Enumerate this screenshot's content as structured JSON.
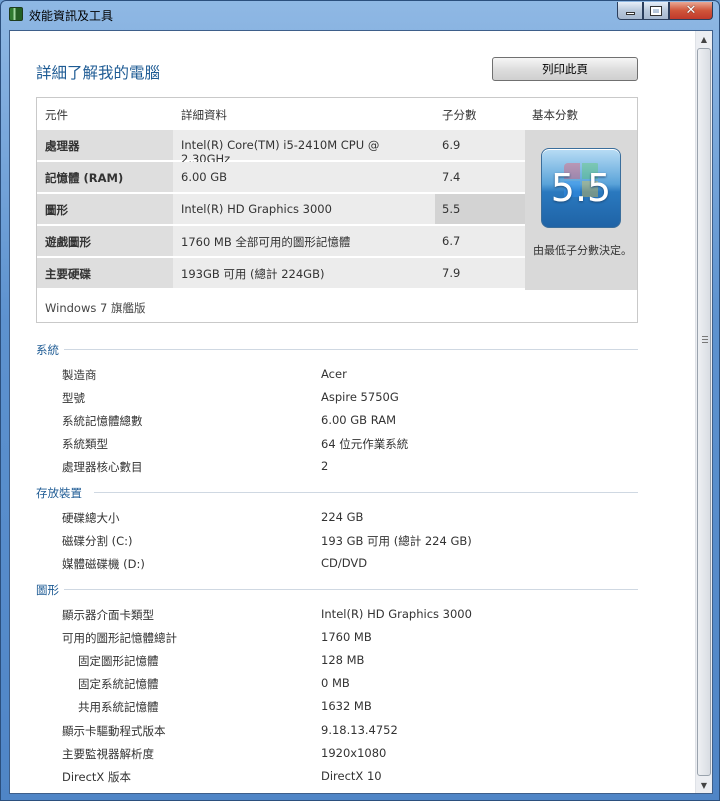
{
  "window": {
    "title": "效能資訊及工具"
  },
  "page_title": "詳細了解我的電腦",
  "print_label": "列印此頁",
  "score_table": {
    "headers": {
      "component": "元件",
      "details": "詳細資料",
      "subscore": "子分數",
      "base": "基本分數"
    },
    "rows": [
      {
        "component": "處理器",
        "details": "Intel(R) Core(TM) i5-2410M CPU @ 2.30GHz",
        "subscore": "6.9"
      },
      {
        "component": "記憶體 (RAM)",
        "details": "6.00 GB",
        "subscore": "7.4"
      },
      {
        "component": "圖形",
        "details": "Intel(R) HD Graphics 3000",
        "subscore": "5.5"
      },
      {
        "component": "遊戲圖形",
        "details": "1760 MB 全部可用的圖形記憶體",
        "subscore": "6.7"
      },
      {
        "component": "主要硬碟",
        "details": "193GB 可用 (總計 224GB)",
        "subscore": "7.9"
      }
    ],
    "base_score": "5.5",
    "base_note": "由最低子分數決定。",
    "os": "Windows 7 旗艦版"
  },
  "sections": {
    "system": {
      "title": "系統",
      "items": [
        {
          "label": "製造商",
          "value": "Acer"
        },
        {
          "label": "型號",
          "value": "Aspire 5750G"
        },
        {
          "label": "系統記憶體總數",
          "value": "6.00 GB RAM"
        },
        {
          "label": "系統類型",
          "value": "64 位元作業系統"
        },
        {
          "label": "處理器核心數目",
          "value": "2"
        }
      ]
    },
    "storage": {
      "title": "存放裝置",
      "items": [
        {
          "label": "硬碟總大小",
          "value": "224 GB"
        },
        {
          "label": "磁碟分割 (C:)",
          "value": "193 GB 可用 (總計 224 GB)"
        },
        {
          "label": "媒體磁碟機 (D:)",
          "value": "CD/DVD"
        }
      ]
    },
    "graphics": {
      "title": "圖形",
      "items": [
        {
          "label": "顯示器介面卡類型",
          "value": "Intel(R) HD Graphics 3000"
        },
        {
          "label": "可用的圖形記憶體總計",
          "value": "1760 MB"
        },
        {
          "label": "固定圖形記憶體",
          "value": "128 MB"
        },
        {
          "label": "固定系統記憶體",
          "value": "0 MB"
        },
        {
          "label": "共用系統記憶體",
          "value": "1632 MB"
        },
        {
          "label": "顯示卡驅動程式版本",
          "value": "9.18.13.4752"
        },
        {
          "label": "主要監視器解析度",
          "value": "1920x1080"
        },
        {
          "label": "DirectX 版本",
          "value": "DirectX 10"
        }
      ]
    }
  }
}
